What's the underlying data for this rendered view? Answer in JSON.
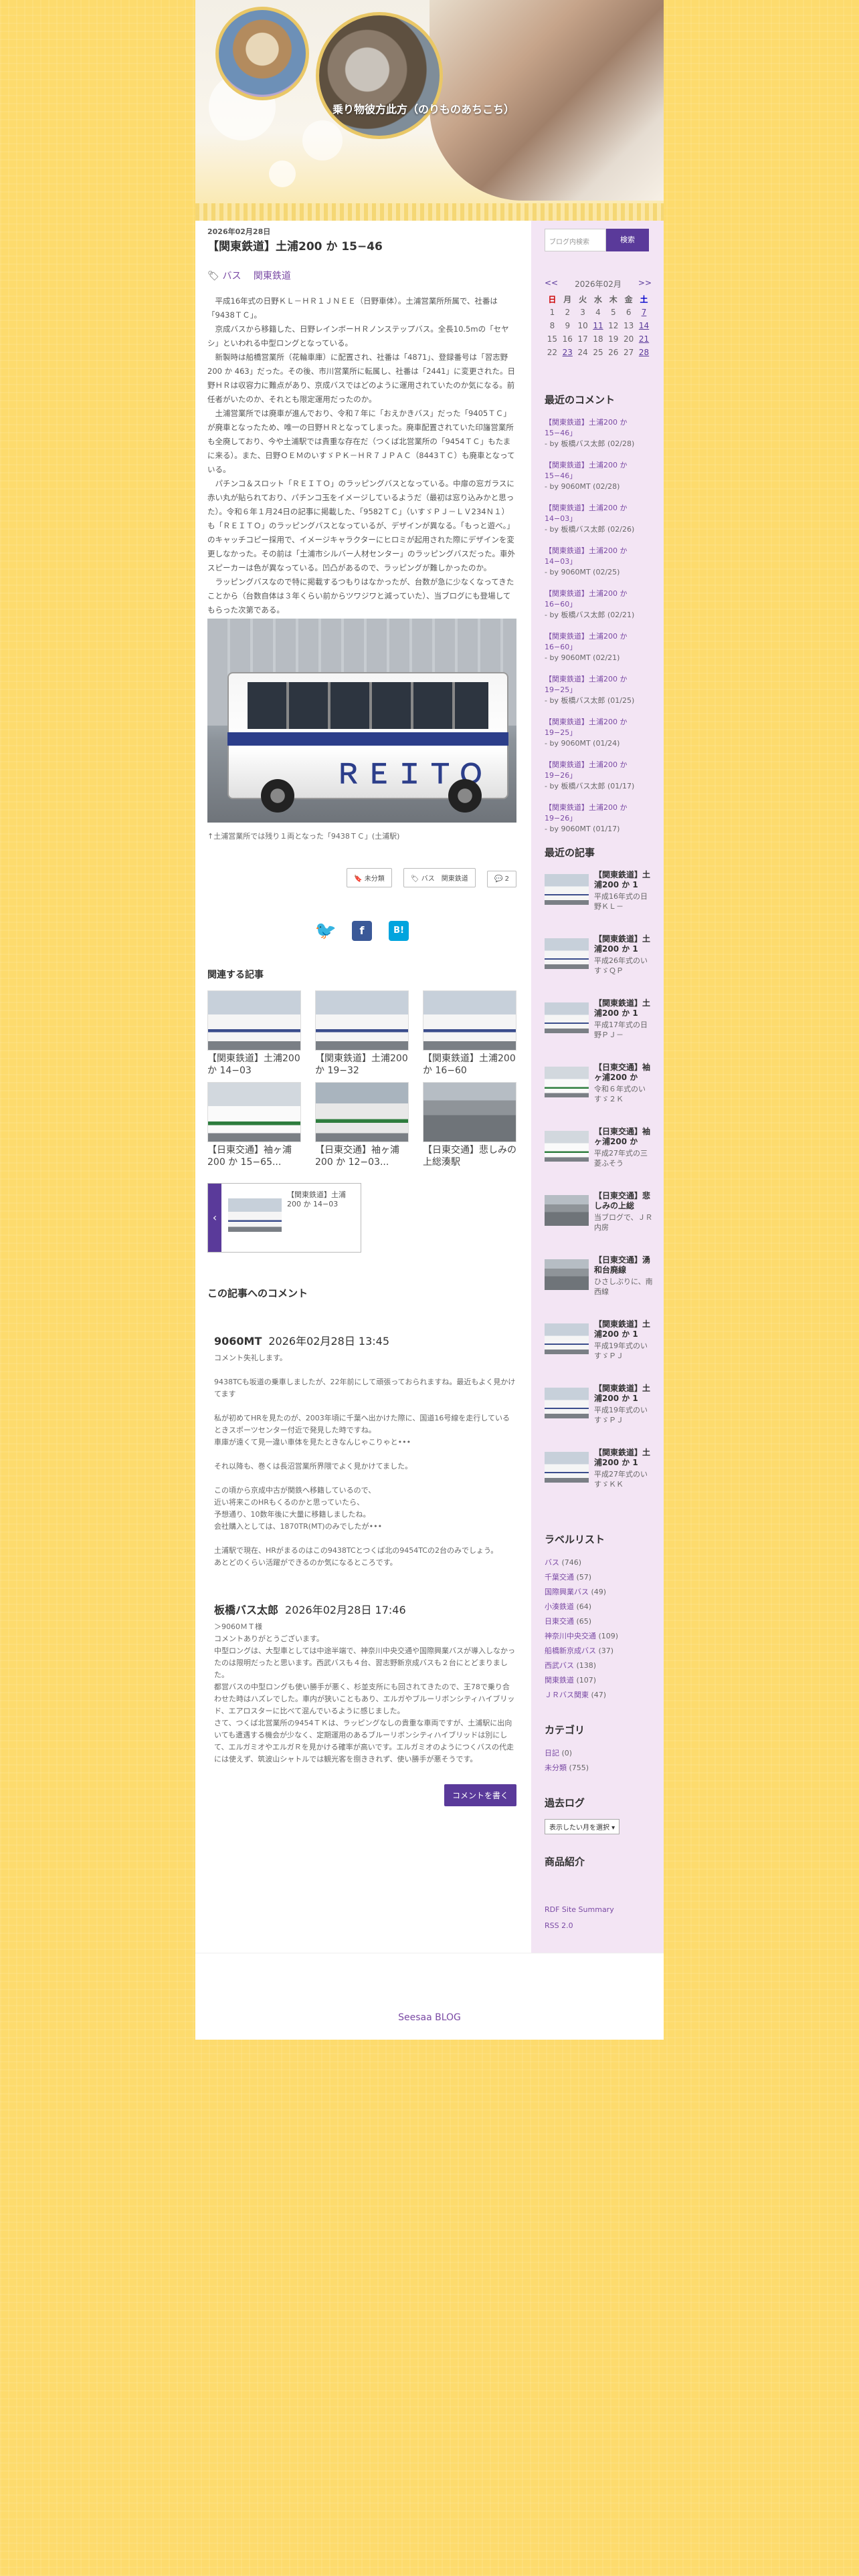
{
  "site": {
    "title": "乗り物彼方此方（のりものあちこち）"
  },
  "post": {
    "date": "2026年02月28日",
    "title": "【関東鉄道】土浦200 か 15−46",
    "categories": [
      "バス",
      "関東鉄道"
    ],
    "paragraphs": [
      "平成16年式の日野ＫＬ－ＨＲ１ＪＮＥＥ（日野車体）。土浦営業所所属で、社番は「9438ＴＣ」。",
      "京成バスから移籍した、日野レインボーＨＲノンステップバス。全長10.5mの「セヤシ」といわれる中型ロングとなっている。",
      "新製時は船橋営業所（花輪車庫）に配置され、社番は「4871」、登録番号は「習志野200 か 463」だった。その後、市川営業所に転属し、社番は「2441」に変更された。日野ＨＲは収容力に難点があり、京成バスではどのように運用されていたのか気になる。前任者がいたのか、それとも限定運用だったのか。",
      "土浦営業所では廃車が進んでおり、令和７年に「おえかきバス」だった「9405ＴＣ」が廃車となったため、唯一の日野ＨＲとなってしまった。廃車配置されていた印旛営業所も全廃しており、今や土浦駅では貴重な存在だ（つくば北営業所の「9454ＴＣ」もたまに来る）。また、日野ＯＥＭのいすゞＰＫ－ＨＲ７ＪＰＡＣ（8443ＴＣ）も廃車となっている。",
      "パチンコ＆スロット「ＲＥＩＴＯ」のラッピングバスとなっている。中扉の窓ガラスに赤い丸が貼られており、パチンコ玉をイメージしているようだ（最初は窓り込みかと思った）。令和６年１月24日の記事に掲載した、「9582ＴＣ」（いすゞＰＪ－ＬＶ234Ｎ１）も「ＲＥＩＴＯ」のラッピングバスとなっているが、デザインが異なる。「もっと遊べ。」のキャッチコピー採用で、イメージキャラクターにヒロミが起用された際にデザインを変更しなかった。その前は「土浦市シルバー人材センター」のラッピングバスだった。車外スピーカーは色が異なっている。凹凸があるので、ラッピングが難しかったのか。",
      "ラッピングバスなので特に掲載するつもりはなかったが、台数が急に少なくなってきたことから（台数自体は３年くらい前からツワジワと減っていた）、当ブログにも登場してもらった次第である。"
    ],
    "photo_caption": "↑土浦営業所では残り１両となった「9438ＴＣ」(土浦駅)",
    "buttons": {
      "unread": "未分類",
      "tags": "バス　関東鉄道",
      "comments": "2"
    },
    "share": {
      "twitter": "twitter-bird",
      "facebook": "f",
      "hatena": "B!"
    }
  },
  "related": {
    "heading": "関連する記事",
    "items": [
      "【関東鉄道】土浦200 か 14−03",
      "【関東鉄道】土浦200 か 19−32",
      "【関東鉄道】土浦200 か 16−60",
      "【日東交通】袖ヶ浦200 か 15−65...",
      "【日東交通】袖ヶ浦200 か 12−03...",
      "【日東交通】悲しみの上総湊駅"
    ],
    "prev": "【関東鉄道】土浦200 か 14−03"
  },
  "comments": {
    "heading": "この記事へのコメント",
    "list": [
      {
        "author": "9060MT",
        "date": "2026年02月28日 13:45",
        "lines": [
          "コメント失礼します。",
          "",
          "9438TCも坂道の乗車しましたが、22年前にして頑張っておられますね。最近もよく見かけてます",
          "",
          "私が初めてHRを見たのが、2003年頃に千葉へ出かけた際に、国道16号線を走行しているときスポーツセンター付近で発見した時ですね。",
          "車庫が遠くて見一違い車体を見たときなんじゃこりゃと•••",
          "",
          "それ以降も、巻くは長沼営業所界隈でよく見かけてました。",
          "",
          "この頃から京成中古が関鉄へ移籍しているので、",
          "近い将来このHRもくるのかと思っていたら、",
          "予想通り、10数年後に大量に移籍しましたね。",
          "会社購入としては、1870TR(MT)のみでしたが•••",
          "",
          "土浦駅で現在、HRがまるのはこの9438TCとつくば北の9454TCの2台のみでしょう。",
          "あとどのくらい活躍ができるのか気になるところです。"
        ]
      },
      {
        "author": "板橋バス太郎",
        "date": "2026年02月28日 17:46",
        "lines": [
          "＞9060ＭＴ様",
          "コメントありがとうございます。",
          "中型ロングは、大型車としては中途半端で、神奈川中央交通や国際興業バスが導入しなかったのは限明だったと思います。西武バスも４台、習志野新京成バスも２台にとどまりました。",
          "都営バスの中型ロングも使い勝手が悪く、杉並支所にも回されてきたので、王78で乗り合わせた時はハズレでした。車内が狭いこともあり、エルガやブルーリボンシティハイブリッド、エアロスターに比べて混んでいるように感じました。",
          "さて、つくば北営業所の9454ＴＫは、ラッピングなしの貴重な車両ですが、土浦駅に出向いても遭遇する機会が少なく、定期運用のあるブルーリボンシティハイブリッドは別にして、エルガミオやエルガＲを見かける確率が高いです。エルガミオのようにつくバスの代走には使えず、筑波山シャトルでは観光客を捌ききれず、使い勝手が悪そうです。"
        ]
      }
    ],
    "write_button": "コメントを書く"
  },
  "sidebar": {
    "search": {
      "placeholder": "ブログ内検索",
      "button": "検索"
    },
    "calendar": {
      "prev": "<<",
      "month": "2026年02月",
      "next": ">>",
      "weekdays": [
        "日",
        "月",
        "火",
        "水",
        "木",
        "金",
        "土"
      ],
      "weeks": [
        [
          "1",
          "2",
          "3",
          "4",
          "5",
          "6",
          "7"
        ],
        [
          "8",
          "9",
          "10",
          "11",
          "12",
          "13",
          "14"
        ],
        [
          "15",
          "16",
          "17",
          "18",
          "19",
          "20",
          "21"
        ],
        [
          "22",
          "23",
          "24",
          "25",
          "26",
          "27",
          "28"
        ]
      ]
    },
    "recent_comments": {
      "heading": "最近のコメント",
      "items": [
        {
          "post": "【関東鉄道】土浦200 か 15−46」",
          "by": "- by 板橋バス太郎 (02/28)"
        },
        {
          "post": "【関東鉄道】土浦200 か 15−46」",
          "by": "- by 9060MT (02/28)"
        },
        {
          "post": "【関東鉄道】土浦200 か 14−03」",
          "by": "- by 板橋バス太郎 (02/26)"
        },
        {
          "post": "【関東鉄道】土浦200 か 14−03」",
          "by": "- by 9060MT (02/25)"
        },
        {
          "post": "【関東鉄道】土浦200 か 16−60」",
          "by": "- by 板橋バス太郎 (02/21)"
        },
        {
          "post": "【関東鉄道】土浦200 か 16−60」",
          "by": "- by 9060MT (02/21)"
        },
        {
          "post": "【関東鉄道】土浦200 か 19−25」",
          "by": "- by 板橋バス太郎 (01/25)"
        },
        {
          "post": "【関東鉄道】土浦200 か 19−25」",
          "by": "- by 9060MT (01/24)"
        },
        {
          "post": "【関東鉄道】土浦200 か 19−26」",
          "by": "- by 板橋バス太郎 (01/17)"
        },
        {
          "post": "【関東鉄道】土浦200 か 19−26」",
          "by": "- by 9060MT (01/17)"
        }
      ]
    },
    "recent_articles": {
      "heading": "最近の記事",
      "items": [
        {
          "title": "【関東鉄道】土浦200 か 1",
          "desc": "平成16年式の日野ＫＬ－"
        },
        {
          "title": "【関東鉄道】土浦200 か 1",
          "desc": "平成26年式のいすゞＱＰ"
        },
        {
          "title": "【関東鉄道】土浦200 か 1",
          "desc": "平成17年式の日野ＰＪ－"
        },
        {
          "title": "【日東交通】袖ヶ浦200 か",
          "desc": "令和６年式のいすゞ２Ｋ"
        },
        {
          "title": "【日東交通】袖ヶ浦200 か",
          "desc": "平成27年式の三菱ふそう"
        },
        {
          "title": "【日東交通】悲しみの上総",
          "desc": "当ブログで、ＪＲ内房"
        },
        {
          "title": "【日東交通】湧和台廃線",
          "desc": "ひさしぶりに、南西線"
        },
        {
          "title": "【関東鉄道】土浦200 か 1",
          "desc": "平成19年式のいすゞＰＪ"
        },
        {
          "title": "【関東鉄道】土浦200 か 1",
          "desc": "平成19年式のいすゞＰＪ"
        },
        {
          "title": "【関東鉄道】土浦200 か 1",
          "desc": "平成27年式のいすゞＫＫ"
        }
      ]
    },
    "labels": {
      "heading": "ラベルリスト",
      "items": [
        {
          "name": "バス",
          "count": "(746)"
        },
        {
          "name": "千葉交通",
          "count": "(57)"
        },
        {
          "name": "国際興業バス",
          "count": "(49)"
        },
        {
          "name": "小湊鉄道",
          "count": "(64)"
        },
        {
          "name": "日東交通",
          "count": "(65)"
        },
        {
          "name": "神奈川中央交通",
          "count": "(109)"
        },
        {
          "name": "船橋新京成バス",
          "count": "(37)"
        },
        {
          "name": "西武バス",
          "count": "(138)"
        },
        {
          "name": "関東鉄道",
          "count": "(107)"
        },
        {
          "name": "ＪＲバス関東",
          "count": "(47)"
        }
      ]
    },
    "categories": {
      "heading": "カテゴリ",
      "items": [
        {
          "name": "日記",
          "count": "(0)"
        },
        {
          "name": "未分類",
          "count": "(755)"
        }
      ]
    },
    "archive": {
      "heading": "過去ログ",
      "select": "表示したい月を選択 ▾"
    },
    "profile": {
      "heading": "商品紹介"
    },
    "links": [
      "RDF Site Summary",
      "RSS 2.0"
    ]
  },
  "footer": {
    "text": "Seesaa BLOG"
  }
}
